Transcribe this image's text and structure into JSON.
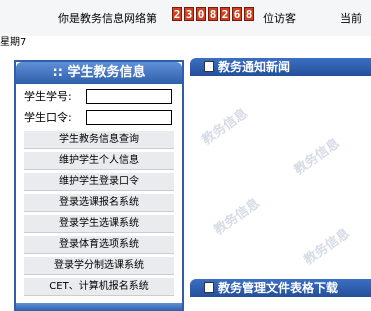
{
  "topbar": {
    "visitor_prefix": "你是教务信息网络第",
    "counter_digits": [
      "2",
      "3",
      "0",
      "8",
      "2",
      "6",
      "8"
    ],
    "visitor_suffix": "位访客",
    "current_label": "当前",
    "weekday": "星期7"
  },
  "sidebar": {
    "title": ":: 学生教务信息",
    "student_id_label": "学生学号:",
    "student_pw_label": "学生口令:",
    "student_id_value": "",
    "student_pw_value": "",
    "menu": [
      "学生教务信息查询",
      "维护学生个人信息",
      "维护学生登录口令",
      "登录选课报名系统",
      "登录学生选课系统",
      "登录体育选项系统",
      "登录学分制选课系统",
      "CET、计算机报名系统"
    ]
  },
  "panels": {
    "news_title": "教务通知新闻",
    "files_title": "教务管理文件表格下载"
  },
  "watermark_text": "教务信息"
}
